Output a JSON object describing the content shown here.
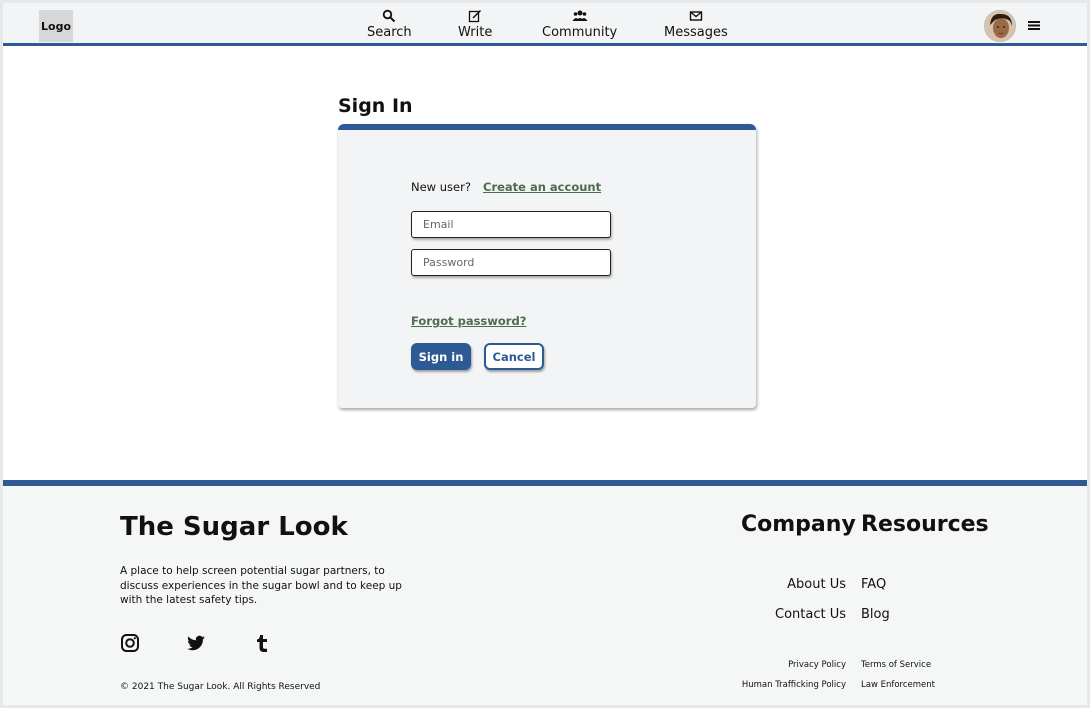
{
  "header": {
    "logo": "Logo",
    "nav": [
      {
        "label": "Search",
        "icon": "search-icon"
      },
      {
        "label": "Write",
        "icon": "write-icon"
      },
      {
        "label": "Community",
        "icon": "community-icon"
      },
      {
        "label": "Messages",
        "icon": "mail-icon"
      }
    ]
  },
  "signin": {
    "title": "Sign In",
    "new_user": "New user?",
    "create_account": "Create an account",
    "email_placeholder": "Email",
    "password_placeholder": "Password",
    "forgot": "Forgot password?",
    "signin_label": "Sign in",
    "cancel_label": "Cancel"
  },
  "footer": {
    "brand": "The Sugar Look",
    "tagline": "A place to help screen potential sugar partners, to discuss experiences in the sugar bowl and to keep up with the latest safety tips.",
    "copyright": "© 2021 The Sugar Look. All Rights Reserved",
    "company": {
      "title": "Company",
      "links": [
        "About Us",
        "Contact Us"
      ],
      "small_links": [
        "Privacy Policy",
        "Human Trafficking Policy"
      ]
    },
    "resources": {
      "title": "Resources",
      "links": [
        "FAQ",
        "Blog"
      ],
      "small_links": [
        "Terms of Service",
        "Law Enforcement"
      ]
    }
  },
  "colors": {
    "accent": "#2d5a95",
    "link": "#4d6b4d",
    "panel": "#f3f4f5"
  }
}
